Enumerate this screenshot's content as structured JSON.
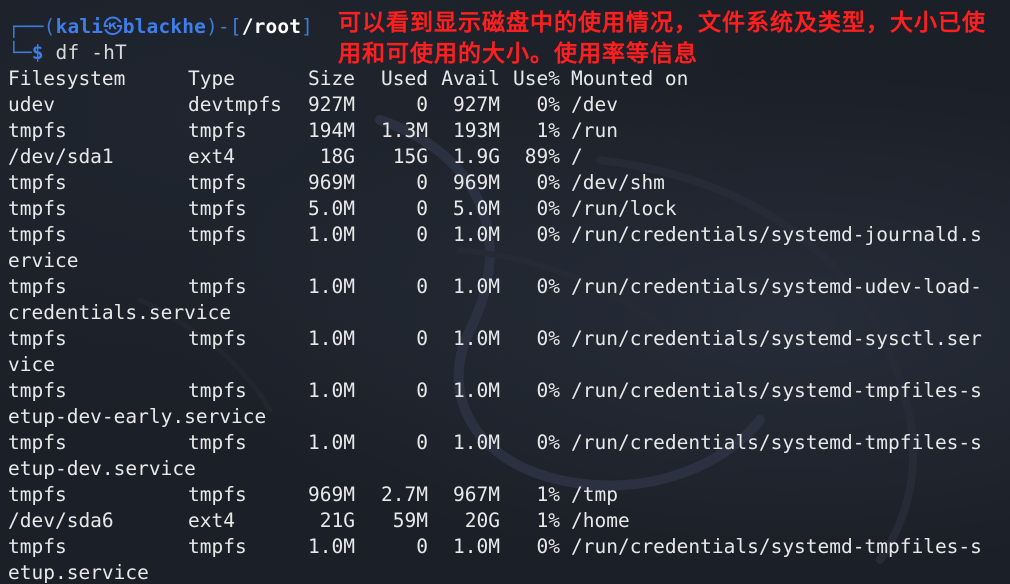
{
  "prompt": {
    "corner_top": "┌──(",
    "user": "kali",
    "at_symbol": "㉿",
    "host": "blackhe",
    "sep": ")-[",
    "dir": "/root",
    "close": "]",
    "corner_bottom": "└─",
    "dollar": "$",
    "command": " df -hT"
  },
  "annotation": {
    "text": "可以看到显示磁盘中的使用情况，文件系统及类型，大小已使用和可使用的大小。使用率等信息",
    "color": "#ff1f1f"
  },
  "table": {
    "headers": [
      "Filesystem",
      "Type",
      "Size",
      "Used",
      "Avail",
      "Use%",
      "Mounted on"
    ],
    "rows": [
      {
        "fs": "udev",
        "type": "devtmpfs",
        "size": "927M",
        "used": "0",
        "avail": "927M",
        "usep": "0%",
        "mount": "/dev",
        "cont": ""
      },
      {
        "fs": "tmpfs",
        "type": "tmpfs",
        "size": "194M",
        "used": "1.3M",
        "avail": "193M",
        "usep": "1%",
        "mount": "/run",
        "cont": ""
      },
      {
        "fs": "/dev/sda1",
        "type": "ext4",
        "size": "18G",
        "used": "15G",
        "avail": "1.9G",
        "usep": "89%",
        "mount": "/",
        "cont": ""
      },
      {
        "fs": "tmpfs",
        "type": "tmpfs",
        "size": "969M",
        "used": "0",
        "avail": "969M",
        "usep": "0%",
        "mount": "/dev/shm",
        "cont": ""
      },
      {
        "fs": "tmpfs",
        "type": "tmpfs",
        "size": "5.0M",
        "used": "0",
        "avail": "5.0M",
        "usep": "0%",
        "mount": "/run/lock",
        "cont": ""
      },
      {
        "fs": "tmpfs",
        "type": "tmpfs",
        "size": "1.0M",
        "used": "0",
        "avail": "1.0M",
        "usep": "0%",
        "mount": "/run/credentials/systemd-journald.s",
        "cont": "ervice"
      },
      {
        "fs": "tmpfs",
        "type": "tmpfs",
        "size": "1.0M",
        "used": "0",
        "avail": "1.0M",
        "usep": "0%",
        "mount": "/run/credentials/systemd-udev-load-",
        "cont": "credentials.service"
      },
      {
        "fs": "tmpfs",
        "type": "tmpfs",
        "size": "1.0M",
        "used": "0",
        "avail": "1.0M",
        "usep": "0%",
        "mount": "/run/credentials/systemd-sysctl.ser",
        "cont": "vice"
      },
      {
        "fs": "tmpfs",
        "type": "tmpfs",
        "size": "1.0M",
        "used": "0",
        "avail": "1.0M",
        "usep": "0%",
        "mount": "/run/credentials/systemd-tmpfiles-s",
        "cont": "etup-dev-early.service"
      },
      {
        "fs": "tmpfs",
        "type": "tmpfs",
        "size": "1.0M",
        "used": "0",
        "avail": "1.0M",
        "usep": "0%",
        "mount": "/run/credentials/systemd-tmpfiles-s",
        "cont": "etup-dev.service"
      },
      {
        "fs": "tmpfs",
        "type": "tmpfs",
        "size": "969M",
        "used": "2.7M",
        "avail": "967M",
        "usep": "1%",
        "mount": "/tmp",
        "cont": ""
      },
      {
        "fs": "/dev/sda6",
        "type": "ext4",
        "size": "21G",
        "used": "59M",
        "avail": "20G",
        "usep": "1%",
        "mount": "/home",
        "cont": ""
      },
      {
        "fs": "tmpfs",
        "type": "tmpfs",
        "size": "1.0M",
        "used": "0",
        "avail": "1.0M",
        "usep": "0%",
        "mount": "/run/credentials/systemd-tmpfiles-s",
        "cont": "etup.service"
      }
    ]
  },
  "colors": {
    "background": "#1b1f27",
    "text": "#e8e8e8",
    "prompt_blue": "#3f7ee8",
    "annotation_red": "#ff1f1f"
  }
}
